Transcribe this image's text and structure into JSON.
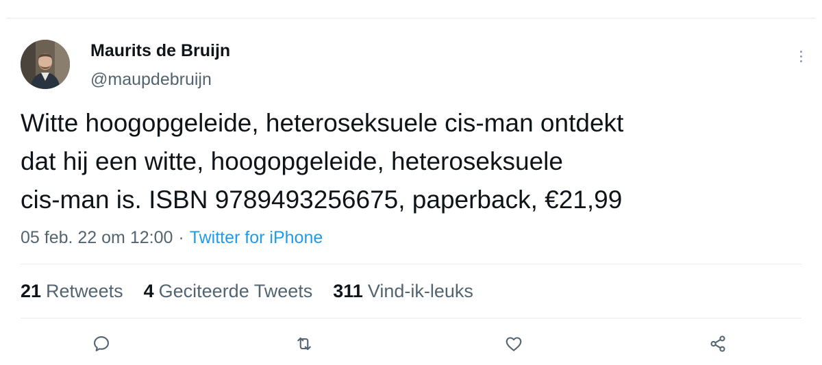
{
  "author": {
    "display_name": "Maurits de Bruijn",
    "handle": "@maupdebruijn"
  },
  "tweet": {
    "lines": [
      "Witte hoogopgeleide, heteroseksuele cis-man ontdekt",
      "dat hij een witte, hoogopgeleide, heteroseksuele",
      "cis-man is. ISBN 9789493256675, paperback, €21,99"
    ]
  },
  "meta": {
    "timestamp": "05 feb. 22 om 12:00",
    "separator": "·",
    "source": "Twitter for iPhone"
  },
  "stats": {
    "retweets_count": "21",
    "retweets_label": "Retweets",
    "quotes_count": "4",
    "quotes_label": "Geciteerde Tweets",
    "likes_count": "311",
    "likes_label": "Vind-ik-leuks"
  },
  "actions": {
    "reply_icon": "reply-icon",
    "retweet_icon": "retweet-icon",
    "like_icon": "heart-icon",
    "share_icon": "share-icon"
  },
  "colors": {
    "link": "#1d9bf0",
    "secondary_text": "#536471",
    "primary_text": "#0f1419",
    "divider": "#e6ecf0"
  }
}
